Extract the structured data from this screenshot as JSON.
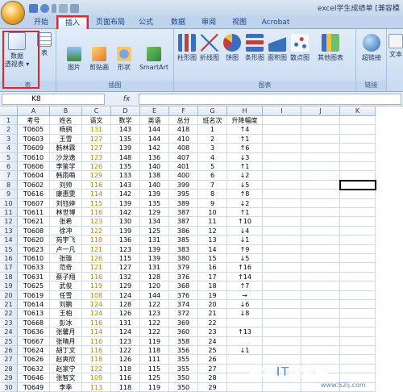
{
  "window": {
    "title": "excel学生成绩单 [兼容模"
  },
  "tabs": [
    {
      "label": "开始",
      "active": false
    },
    {
      "label": "插入",
      "active": true
    },
    {
      "label": "页面布局",
      "active": false
    },
    {
      "label": "公式",
      "active": false
    },
    {
      "label": "数据",
      "active": false
    },
    {
      "label": "审阅",
      "active": false
    },
    {
      "label": "视图",
      "active": false
    },
    {
      "label": "Acrobat",
      "active": false
    }
  ],
  "ribbon": {
    "groups": {
      "tables": "表",
      "illustrations": "插图",
      "charts": "图表",
      "links": "链接"
    },
    "buttons": {
      "pivot": "数据\n透视表 ▾",
      "table": "表",
      "picture": "图片",
      "clipart": "剪贴画",
      "shapes": "形状",
      "smartart": "SmartArt",
      "column": "柱形图",
      "line": "折线图",
      "pie": "饼图",
      "bar": "条形图",
      "area": "面积图",
      "scatter": "散点图",
      "other": "其他图表",
      "hyperlink": "超链接",
      "text": "文本"
    }
  },
  "formula_bar": {
    "name_box": "K8",
    "fx": "fx",
    "value": ""
  },
  "sheet": {
    "columns": [
      "A",
      "B",
      "C",
      "D",
      "E",
      "F",
      "G",
      "H",
      "I",
      "J",
      "K"
    ],
    "selected_cell": "K8",
    "rows": [
      [
        "考号",
        "姓名",
        "语文",
        "数学",
        "英语",
        "总分",
        "班名次",
        "升降幅度"
      ],
      [
        "T0605",
        "杨鹞",
        "131",
        "143",
        "144",
        "418",
        "1",
        "↑4"
      ],
      [
        "T0603",
        "王雪",
        "127",
        "135",
        "144",
        "410",
        "2",
        "↑1"
      ],
      [
        "T0609",
        "韩林霖",
        "127",
        "139",
        "142",
        "408",
        "3",
        "↑6"
      ],
      [
        "T0610",
        "沙龙逸",
        "123",
        "148",
        "136",
        "407",
        "4",
        "↓3"
      ],
      [
        "T0606",
        "李鉴学",
        "126",
        "135",
        "140",
        "401",
        "5",
        "↑1"
      ],
      [
        "T0604",
        "韩雨萌",
        "129",
        "133",
        "138",
        "400",
        "6",
        "↓2"
      ],
      [
        "T0602",
        "刘帅",
        "116",
        "143",
        "140",
        "399",
        "7",
        "↓5"
      ],
      [
        "T0616",
        "康惠雯",
        "114",
        "142",
        "139",
        "395",
        "8",
        "↑8"
      ],
      [
        "T0607",
        "刘钰婷",
        "115",
        "139",
        "135",
        "389",
        "9",
        "↓2"
      ],
      [
        "T0611",
        "林世博",
        "116",
        "142",
        "129",
        "387",
        "10",
        "↑1"
      ],
      [
        "T0621",
        "张希",
        "123",
        "130",
        "134",
        "387",
        "11",
        "↑10"
      ],
      [
        "T0608",
        "徐冲",
        "122",
        "139",
        "125",
        "386",
        "12",
        "↓4"
      ],
      [
        "T0620",
        "苑宇飞",
        "118",
        "136",
        "131",
        "385",
        "13",
        "↓1"
      ],
      [
        "T0623",
        "卢一凡",
        "121",
        "123",
        "139",
        "383",
        "14",
        "↑9"
      ],
      [
        "T0610",
        "张璇",
        "126",
        "115",
        "139",
        "380",
        "15",
        "↓5"
      ],
      [
        "T0633",
        "范奇",
        "121",
        "127",
        "131",
        "379",
        "16",
        "↑16"
      ],
      [
        "T0631",
        "蔡子翔",
        "116",
        "132",
        "128",
        "376",
        "17",
        "↑14"
      ],
      [
        "T0625",
        "武俊",
        "119",
        "129",
        "120",
        "368",
        "18",
        "↑7"
      ],
      [
        "T0619",
        "任雪",
        "108",
        "124",
        "144",
        "376",
        "19",
        "→"
      ],
      [
        "T0614",
        "刘鹏",
        "124",
        "128",
        "122",
        "374",
        "20",
        "↓6"
      ],
      [
        "T0613",
        "王柏",
        "124",
        "126",
        "123",
        "372",
        "21",
        "↓8"
      ],
      [
        "T0668",
        "彭冰",
        "116",
        "131",
        "122",
        "369",
        "22",
        ""
      ],
      [
        "T0636",
        "张馨月",
        "114",
        "124",
        "122",
        "360",
        "23",
        "↑13"
      ],
      [
        "T0667",
        "张晴月",
        "116",
        "123",
        "119",
        "358",
        "24",
        ""
      ],
      [
        "T0624",
        "胡丁文",
        "116",
        "122",
        "118",
        "356",
        "25",
        "↓1"
      ],
      [
        "T0626",
        "赵爽欣",
        "118",
        "126",
        "111",
        "355",
        "26",
        ""
      ],
      [
        "T0632",
        "赵家宁",
        "122",
        "118",
        "115",
        "355",
        "27",
        ""
      ],
      [
        "T0646",
        "张智文",
        "109",
        "116",
        "125",
        "350",
        "28",
        ""
      ],
      [
        "T0649",
        "李季",
        "113",
        "118",
        "119",
        "350",
        "29",
        ""
      ]
    ]
  },
  "watermark": {
    "text": "我爱IT技术网",
    "url": "www.52ij.com"
  },
  "colors": {
    "accent": "#15428b",
    "highlight": "#e8202a",
    "score_text": "#c08a00"
  }
}
